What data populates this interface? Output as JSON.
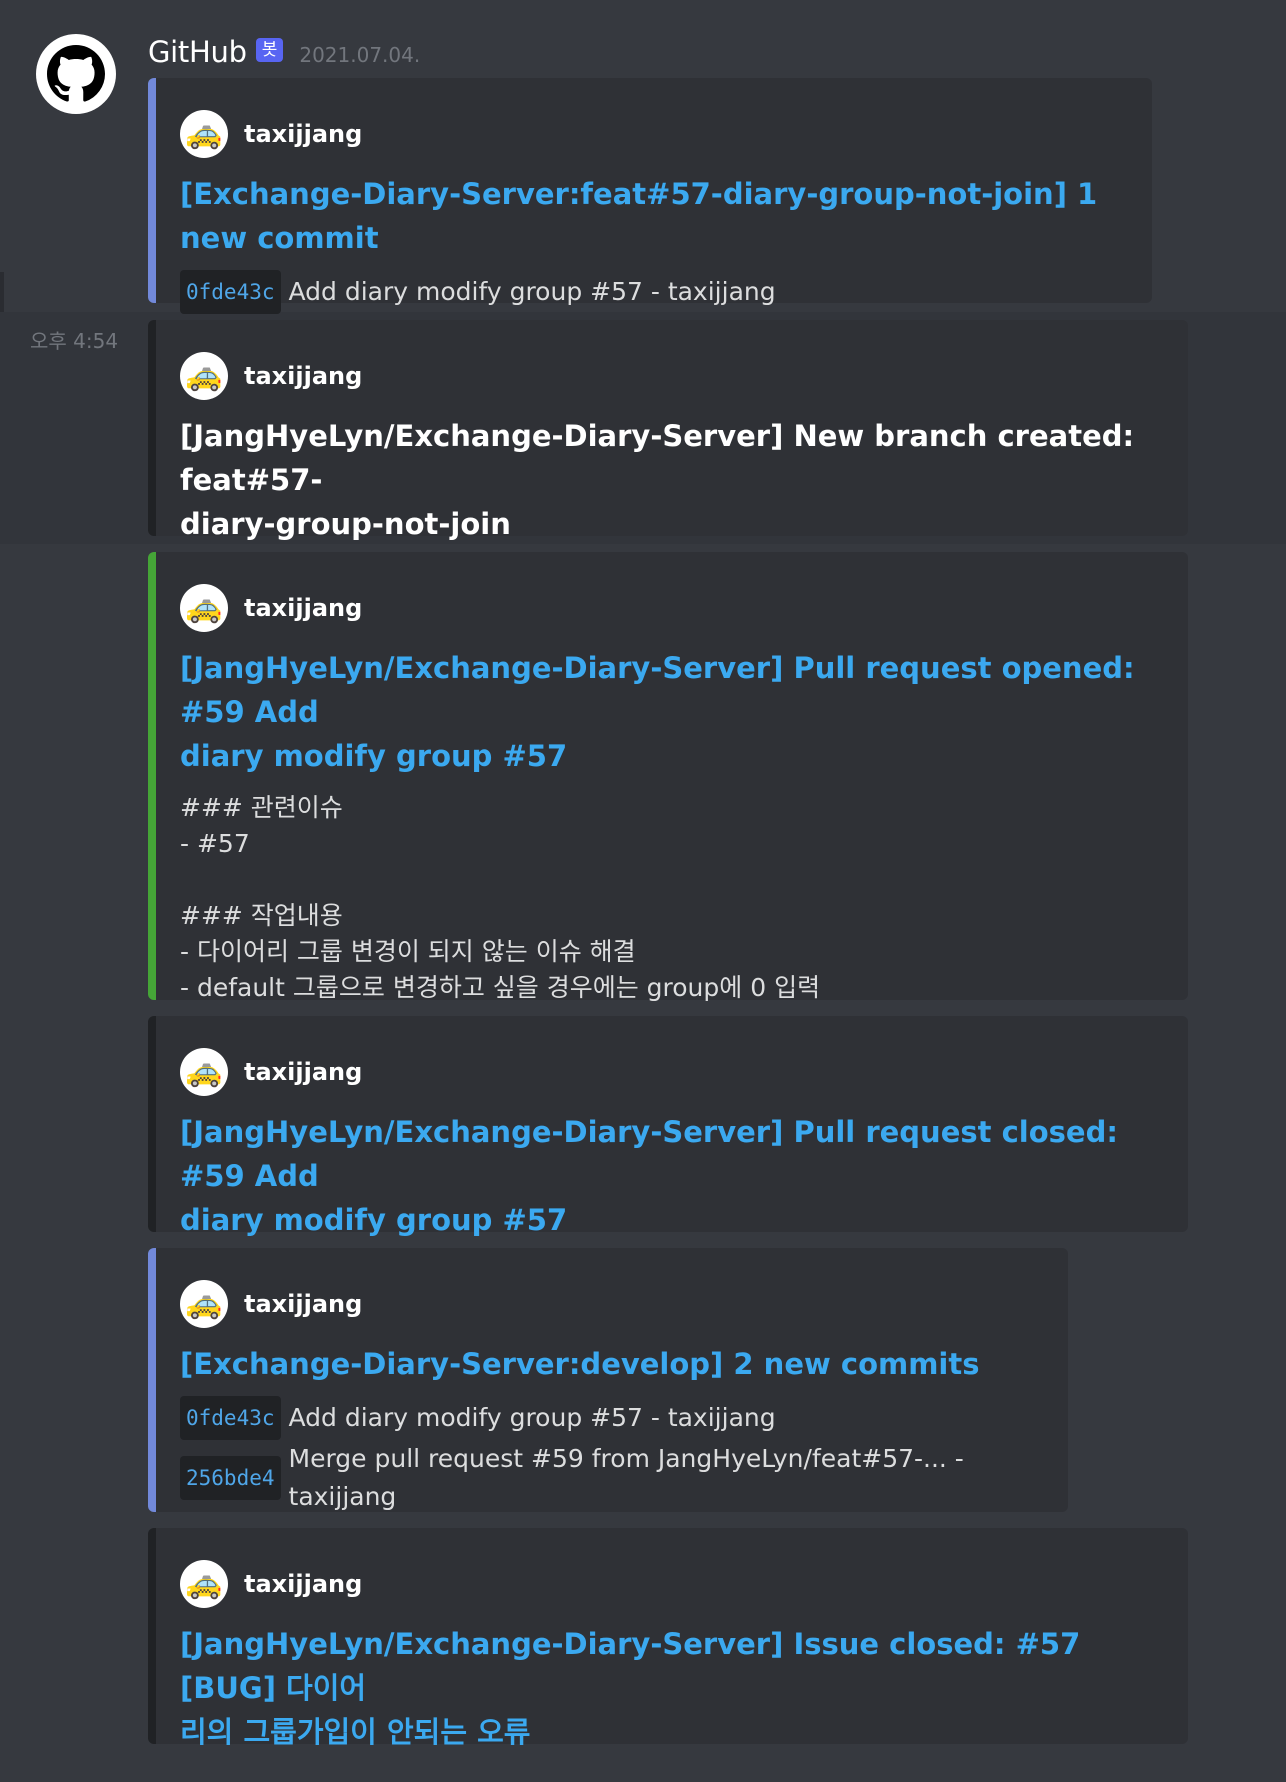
{
  "message": {
    "author": "GitHub",
    "bot_tag": "봇",
    "timestamp": "2021.07.04.",
    "avatar_icon": "github-icon"
  },
  "left_time": "오후 4:54",
  "embeds": [
    {
      "author": "taxijjang",
      "author_icon": "taxi-icon",
      "title_line1": "[Exchange-Diary-Server:feat#57-diary-group-not-join] 1 new commit",
      "commits": [
        {
          "hash": "0fde43c",
          "text": "Add diary modify group #57 - taxijjang"
        }
      ]
    },
    {
      "author": "taxijjang",
      "author_icon": "taxi-icon",
      "title_line1": "[JangHyeLyn/Exchange-Diary-Server] New branch created: feat#57-",
      "title_line2": "diary-group-not-join"
    },
    {
      "author": "taxijjang",
      "author_icon": "taxi-icon",
      "title_line1": "[JangHyeLyn/Exchange-Diary-Server] Pull request opened: #59 Add",
      "title_line2": "diary modify group #57",
      "description": "### 관련이슈\n- #57\n\n### 작업내용\n- 다이어리 그룹 변경이 되지 않는 이슈 해결\n- default 그룹으로 변경하고 싶을 경우에는 group에 0 입력"
    },
    {
      "author": "taxijjang",
      "author_icon": "taxi-icon",
      "title_line1": "[JangHyeLyn/Exchange-Diary-Server] Pull request closed: #59 Add",
      "title_line2": "diary modify group #57"
    },
    {
      "author": "taxijjang",
      "author_icon": "taxi-icon",
      "title_line1": "[Exchange-Diary-Server:develop] 2 new commits",
      "commits": [
        {
          "hash": "0fde43c",
          "text": "Add diary modify group #57 - taxijjang"
        },
        {
          "hash": "256bde4",
          "text": "Merge pull request #59 from JangHyeLyn/feat#57-... - taxijjang"
        }
      ]
    },
    {
      "author": "taxijjang",
      "author_icon": "taxi-icon",
      "title_line1": "[JangHyeLyn/Exchange-Diary-Server] Issue closed: #57 [BUG] 다이어",
      "title_line2": "리의 그룹가입이 안되는 오류"
    }
  ],
  "colors": {
    "background": "#36393f",
    "embed_bg": "#2f3136",
    "link": "#3ba9f0",
    "accent_blurple": "#7289da",
    "accent_green": "#45a537",
    "bot_tag": "#5865f2"
  }
}
